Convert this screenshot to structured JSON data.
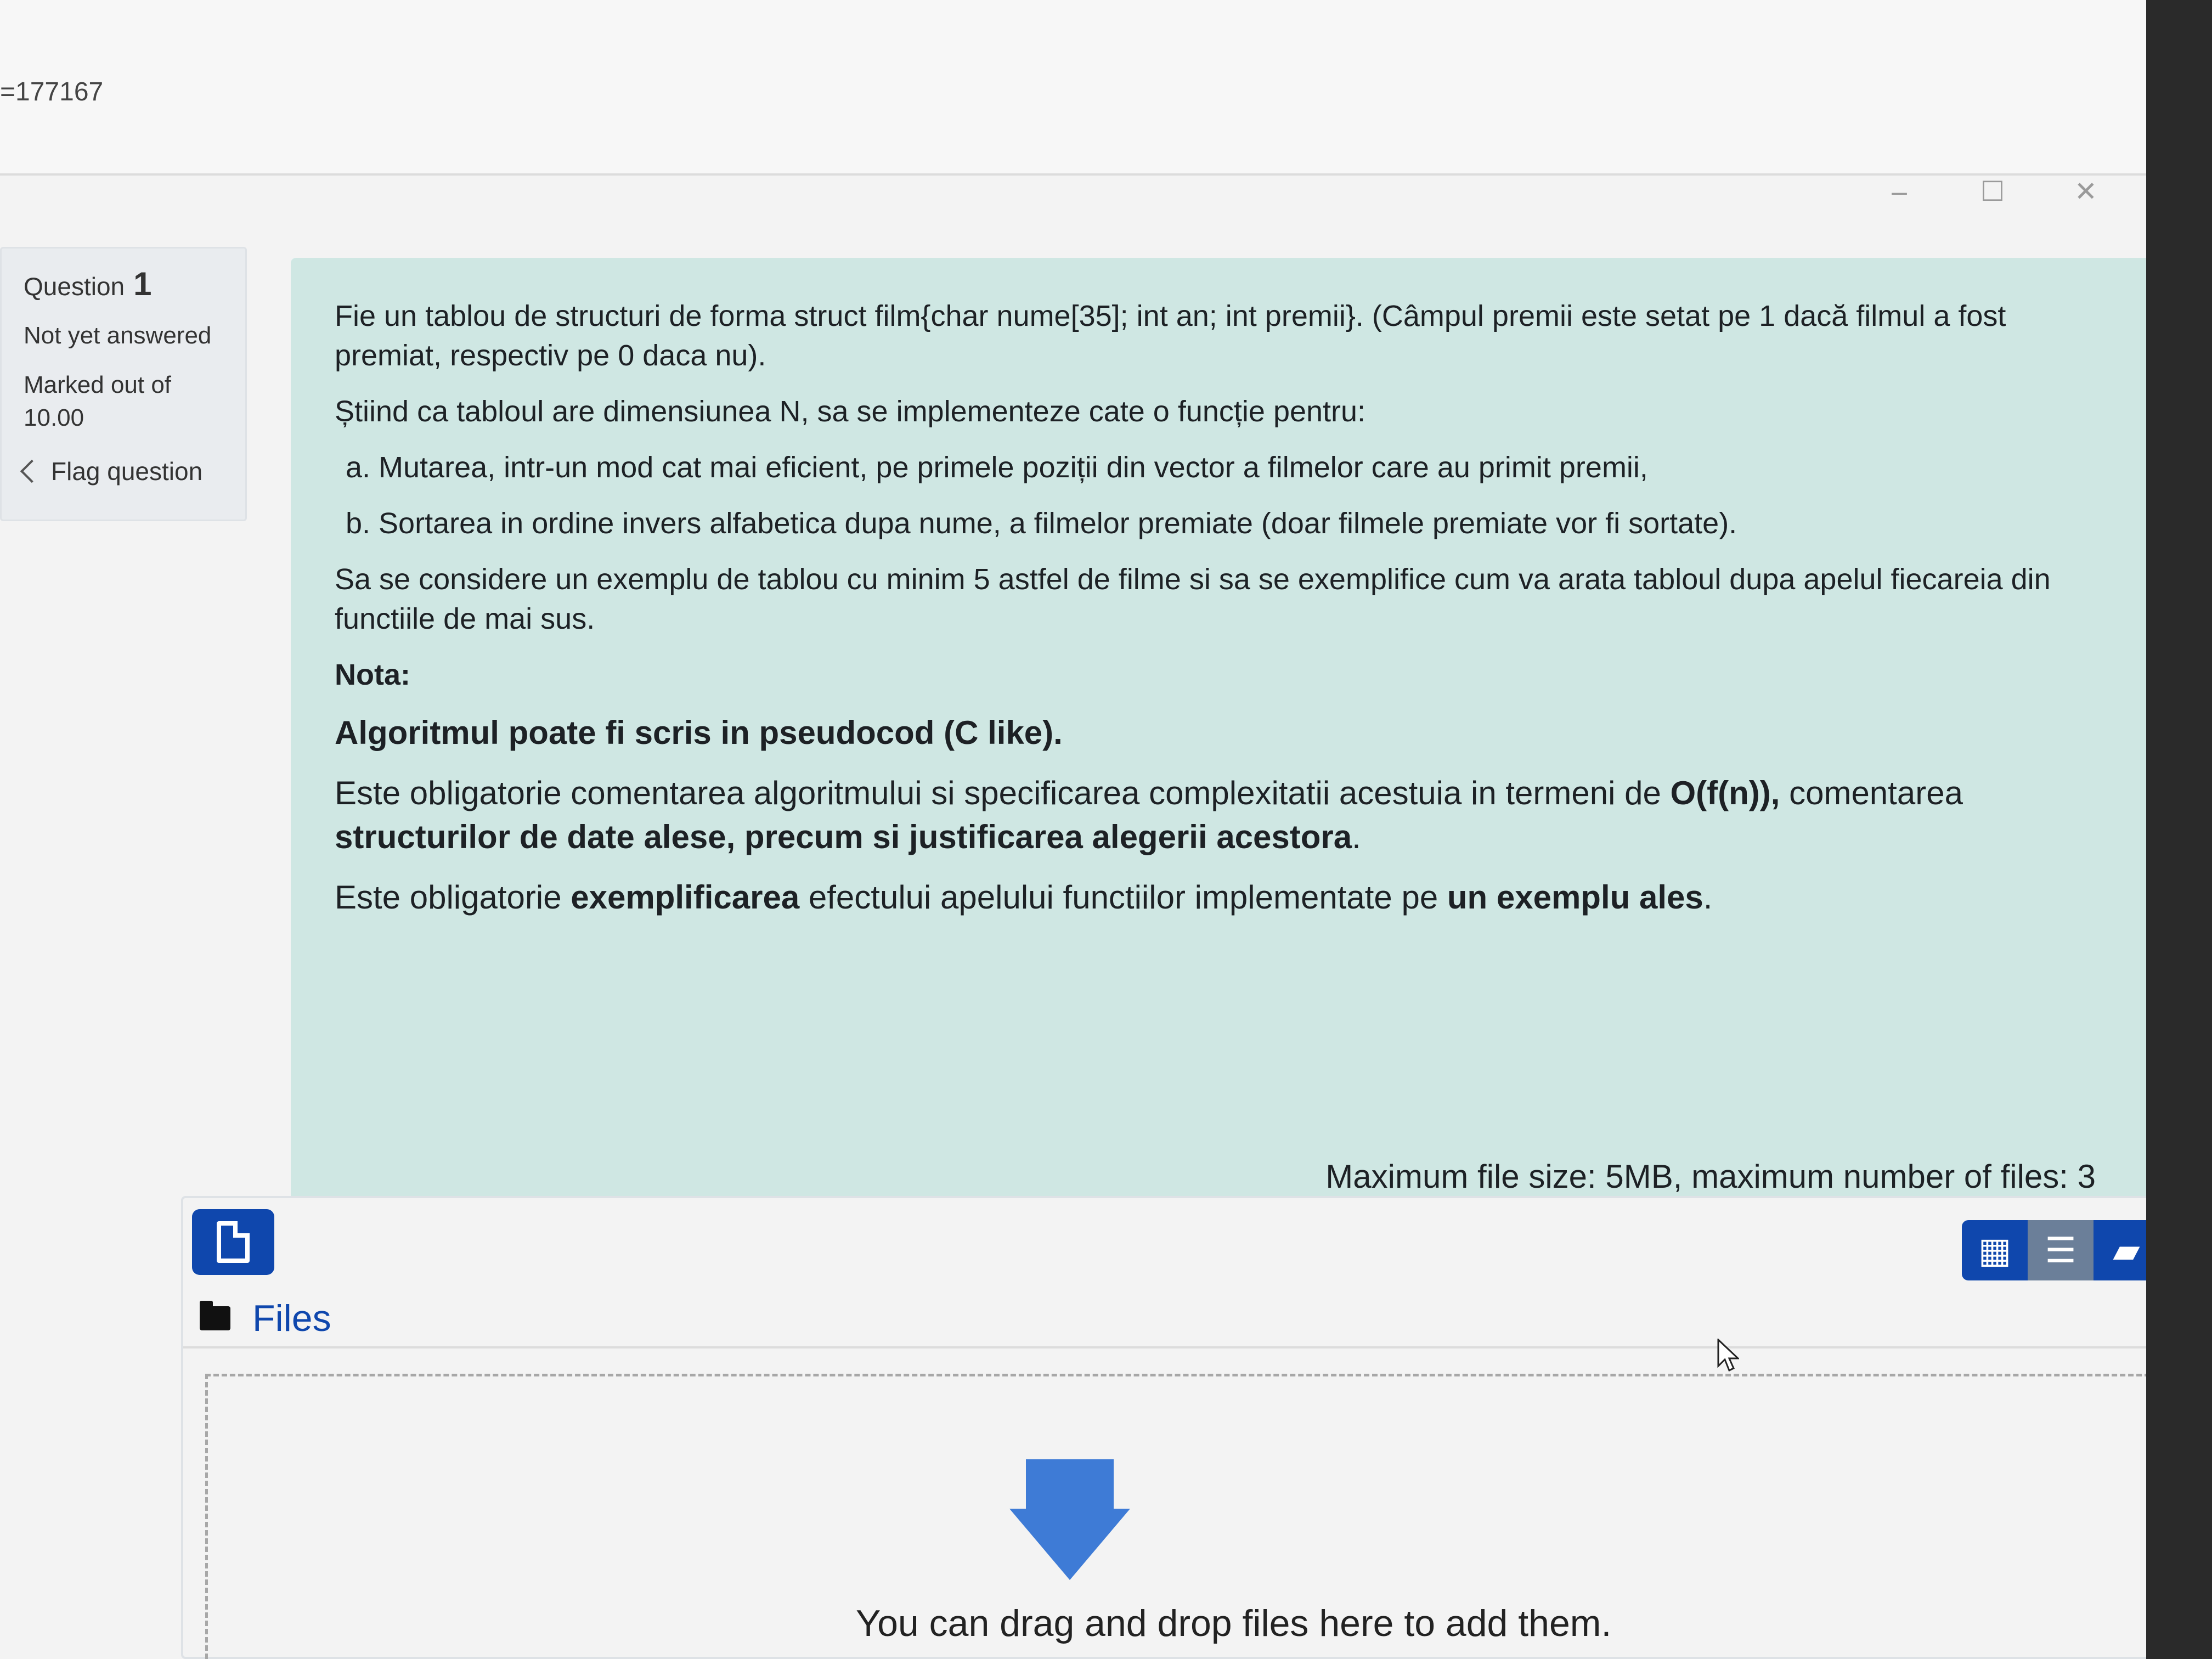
{
  "browser": {
    "url_fragment": "=177167"
  },
  "question_info": {
    "label": "Question",
    "number": "1",
    "state": "Not yet answered",
    "marked_label": "Marked out of",
    "marked_value": "10.00",
    "flag_label": "Flag question"
  },
  "question": {
    "p1": "Fie un tablou de structuri de forma struct film{char nume[35]; int an; int premii}. (Câmpul premii este setat pe 1 dacă filmul a fost premiat, respectiv pe 0 daca nu).",
    "p2": "Știind ca tabloul are dimensiunea N, sa se implementeze cate o funcție pentru:",
    "item_a": "a. Mutarea, intr-un mod cat mai eficient, pe primele poziții din vector a filmelor care au primit premii,",
    "item_b": "b. Sortarea in ordine invers alfabetica dupa nume, a filmelor premiate (doar filmele premiate vor fi sortate).",
    "p3": "Sa se considere un exemplu de tablou cu minim 5 astfel de filme si sa se exemplifice cum va arata tabloul dupa apelul fiecareia din functiile de mai sus.",
    "nota": "Nota:",
    "algoritm": "Algoritmul poate fi scris in pseudocod (C like).",
    "p4_a": "Este obligatorie comentarea algoritmului si specificarea complexitatii acestuia in termeni de ",
    "p4_b": "O(f(n)),",
    "p4_c": " comentarea ",
    "p4_d": "structurilor de date alese, precum si justificarea alegerii acestora",
    "p4_e": ".",
    "p5_a": "Este obligatorie ",
    "p5_b": "exemplificarea",
    "p5_c": " efectului apelului functiilor implementate pe ",
    "p5_d": "un exemplu ales",
    "p5_e": "."
  },
  "filemanager": {
    "limits": "Maximum file size: 5MB, maximum number of files: 3",
    "path_label": "Files",
    "drop_text": "You can drag and drop files here to add them.",
    "add_icon": "add-file-icon",
    "view_icons": [
      "grid-view-icon",
      "list-view-icon",
      "tree-view-icon"
    ],
    "accent_color": "#0f47ad"
  },
  "window_controls": [
    "–",
    "☐",
    "✕"
  ]
}
